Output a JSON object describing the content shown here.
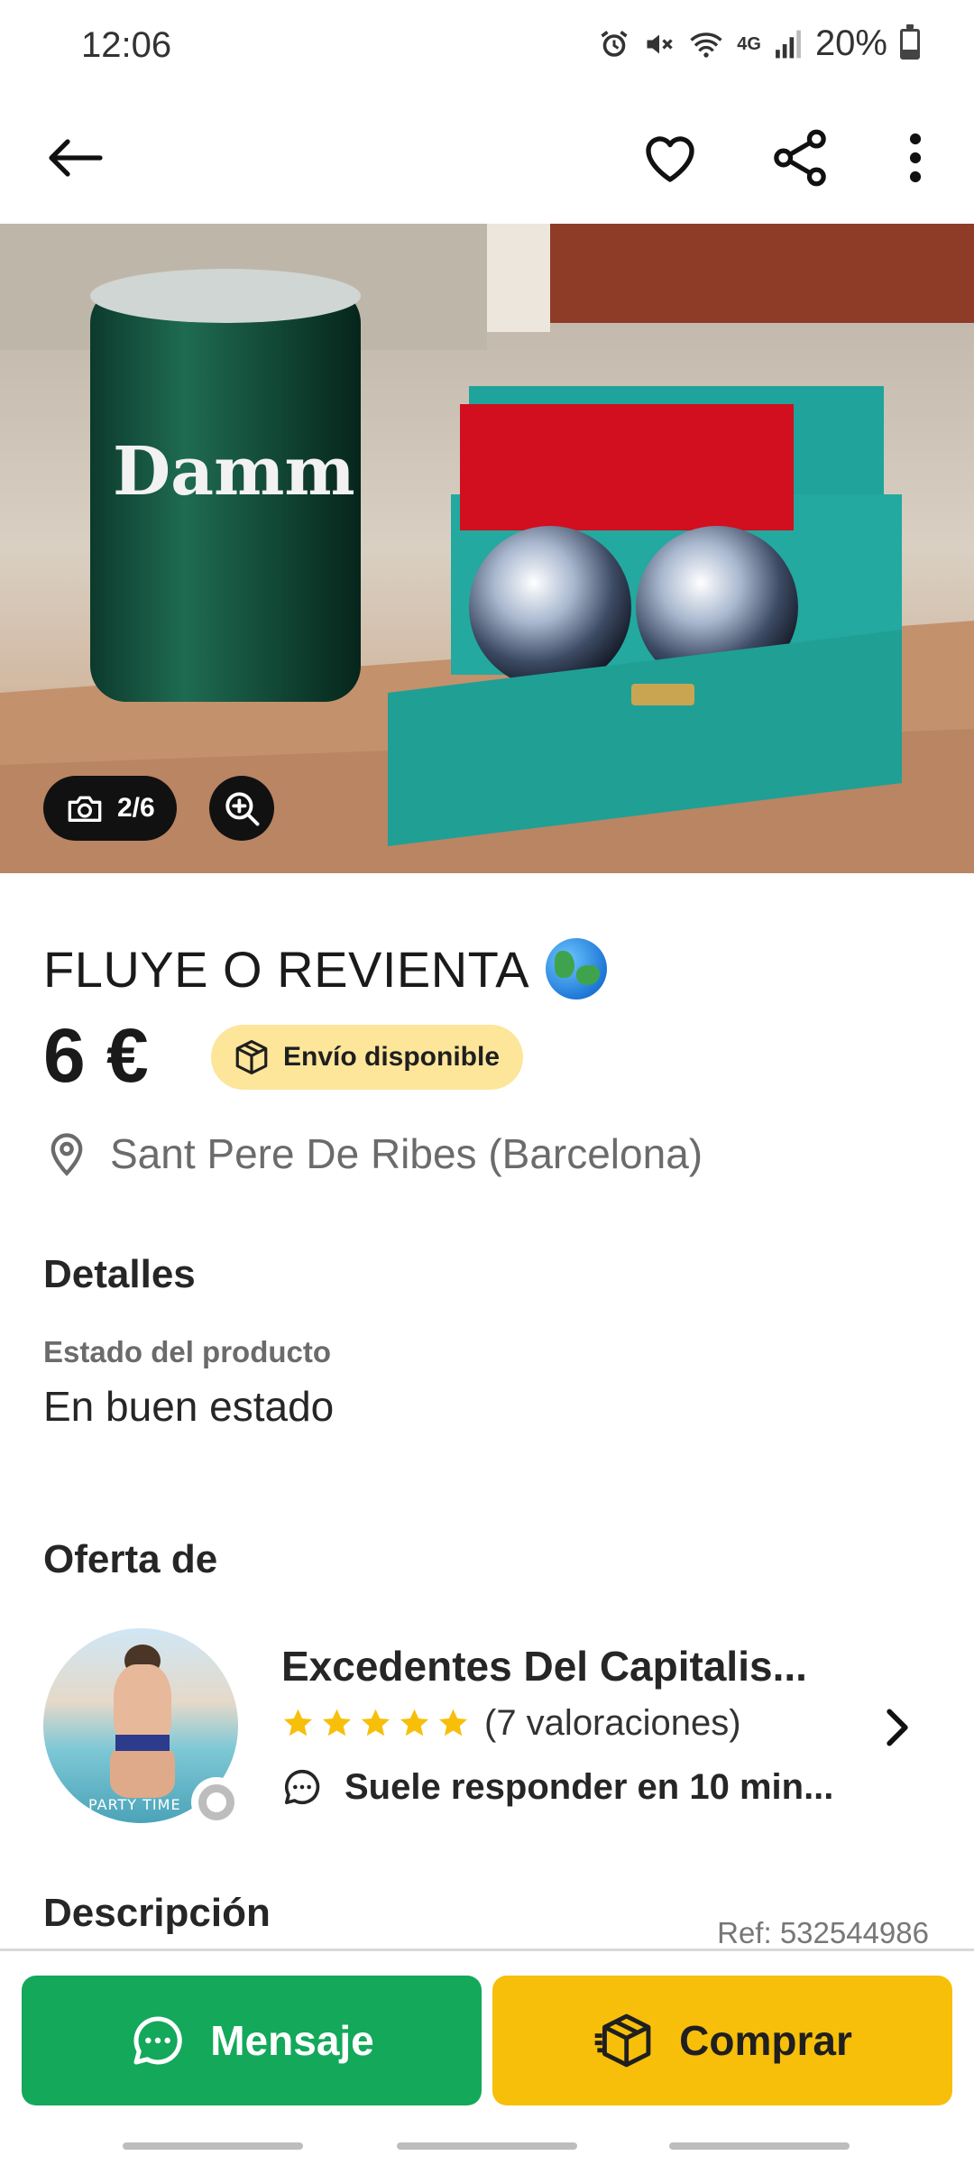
{
  "status_bar": {
    "time": "12:06",
    "network": "4G",
    "battery": "20%",
    "icons": [
      "alarm-icon",
      "mute-icon",
      "wifi-icon",
      "signal-icon",
      "battery-icon"
    ]
  },
  "app_bar": {
    "icons": [
      "back-arrow-icon",
      "heart-icon",
      "share-icon",
      "more-vertical-icon"
    ]
  },
  "gallery": {
    "counter": "2/6"
  },
  "product": {
    "title": "FLUYE O REVIENTA",
    "price": "6 €",
    "shipping_badge": "Envío disponible",
    "location": "Sant Pere De Ribes (Barcelona)"
  },
  "details": {
    "heading": "Detalles",
    "condition_label": "Estado del producto",
    "condition_value": "En buen estado"
  },
  "seller": {
    "heading": "Oferta de",
    "name": "Excedentes Del Capitalis...",
    "rating_stars": 5,
    "ratings_count": "(7 valoraciones)",
    "response_time": "Suele responder en 10 min...",
    "avatar_caption": "PARTY TIME"
  },
  "description": {
    "heading": "Descripción",
    "ref": "Ref: 532544986"
  },
  "actions": {
    "message_label": "Mensaje",
    "buy_label": "Comprar"
  },
  "colors": {
    "message_button": "#13a85a",
    "buy_button": "#f7bf0a",
    "shipping_badge": "#fde59a",
    "star": "#f7bf0a"
  }
}
